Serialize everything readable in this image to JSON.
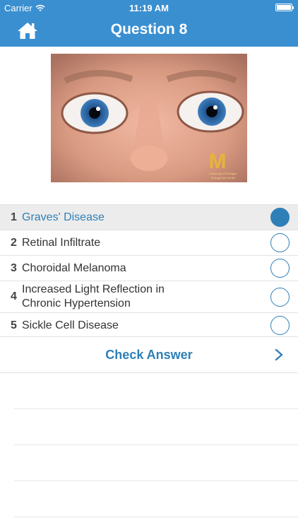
{
  "status_bar": {
    "carrier": "Carrier",
    "time": "11:19 AM"
  },
  "header": {
    "title": "Question 8",
    "home_icon": "home-icon"
  },
  "image": {
    "watermark": "University of Michigan Kellogg Eye Center"
  },
  "answers": [
    {
      "number": "1",
      "label": "Graves' Disease",
      "selected": true
    },
    {
      "number": "2",
      "label": "Retinal Infiltrate",
      "selected": false
    },
    {
      "number": "3",
      "label": "Choroidal Melanoma",
      "selected": false
    },
    {
      "number": "4",
      "label": "Increased Light Reflection in Chronic Hypertension",
      "selected": false
    },
    {
      "number": "5",
      "label": "Sickle Cell Disease",
      "selected": false
    }
  ],
  "check_answer": {
    "label": "Check Answer",
    "icon": "chevron-right-icon"
  },
  "colors": {
    "header": "#3a8fd0",
    "accent": "#2e7fb8",
    "selected_row": "#ececec"
  }
}
